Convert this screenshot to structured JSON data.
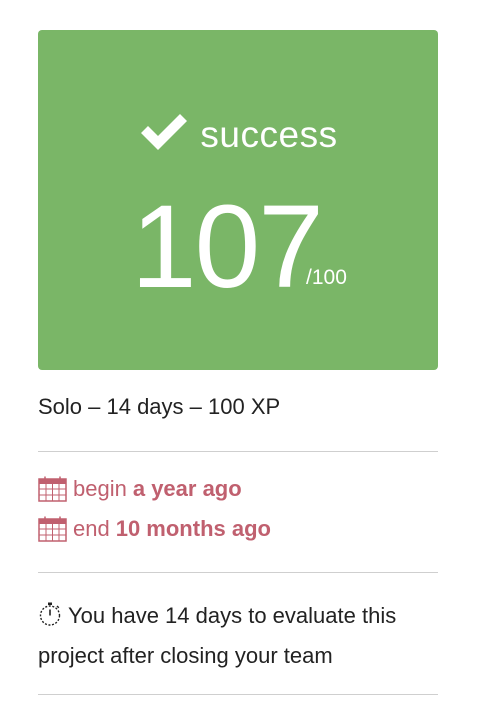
{
  "result": {
    "status": "success",
    "grade": "107",
    "grade_max": "/100",
    "status_color": "#7ab667"
  },
  "project": {
    "meta": "Solo – 14 days – 100 XP"
  },
  "dates": {
    "begin_label": "begin",
    "begin_value": "a year ago",
    "end_label": "end",
    "end_value": "10 months ago",
    "color": "#c0606f"
  },
  "evaluation": {
    "note": "You have 14 days to evaluate this project after closing your team"
  },
  "icons": {
    "status": "check-icon",
    "dates": "calendar-icon",
    "evaluation": "timer-icon"
  }
}
